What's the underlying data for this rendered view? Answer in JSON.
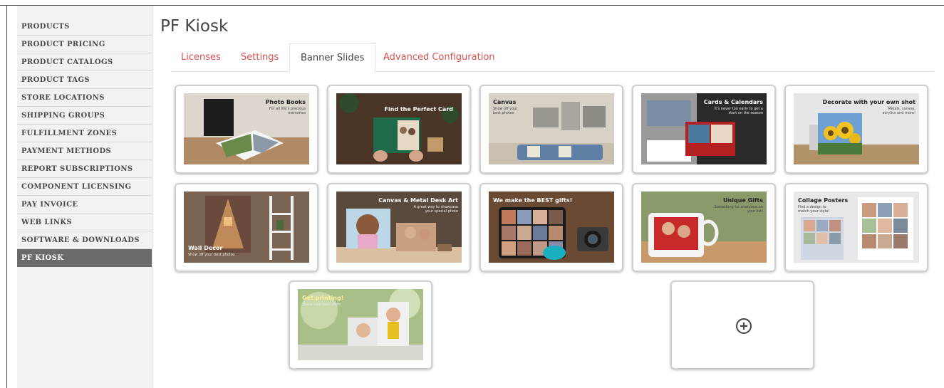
{
  "sidebar": {
    "items": [
      {
        "label": "PRODUCTS"
      },
      {
        "label": "PRODUCT PRICING"
      },
      {
        "label": "PRODUCT CATALOGS"
      },
      {
        "label": "PRODUCT TAGS"
      },
      {
        "label": "STORE LOCATIONS"
      },
      {
        "label": "SHIPPING GROUPS"
      },
      {
        "label": "FULFILLMENT ZONES"
      },
      {
        "label": "PAYMENT METHODS"
      },
      {
        "label": "REPORT SUBSCRIPTIONS"
      },
      {
        "label": "COMPONENT LICENSING"
      },
      {
        "label": "PAY INVOICE"
      },
      {
        "label": "WEB LINKS"
      },
      {
        "label": "SOFTWARE & DOWNLOADS"
      },
      {
        "label": "PF KIOSK",
        "active": true
      }
    ]
  },
  "page": {
    "title": "PF Kiosk"
  },
  "tabs": [
    {
      "label": "Licenses"
    },
    {
      "label": "Settings"
    },
    {
      "label": "Banner Slides",
      "active": true
    },
    {
      "label": "Advanced Configuration"
    }
  ],
  "slides": [
    {
      "title": "Photo Books",
      "subtitle": "For all life's precious memories"
    },
    {
      "title": "Find the Perfect Card",
      "subtitle": ""
    },
    {
      "title": "Canvas",
      "subtitle": "Show off your best photos"
    },
    {
      "title": "Cards & Calendars",
      "subtitle": "It's never too early to get a start on the season"
    },
    {
      "title": "Decorate with your own shot",
      "subtitle": "Metals, canvas, acrylics and more!"
    },
    {
      "title": "Wall Decor",
      "subtitle": "Show off your best photos"
    },
    {
      "title": "Canvas & Metal Desk Art",
      "subtitle": "A great way to showcase your special photo"
    },
    {
      "title": "We make the BEST gifts!",
      "subtitle": ""
    },
    {
      "title": "Unique Gifts",
      "subtitle": "Something for everyone on your list!"
    },
    {
      "title": "Collage Posters",
      "subtitle": "Find a design to match your style!"
    },
    {
      "title": "Get printing!",
      "subtitle": "Share your best shots"
    }
  ],
  "add_slide": {
    "icon": "plus-circle-icon"
  },
  "colors": {
    "tab_link": "#d9534f",
    "sidebar_active": "#6b6b6b",
    "sidebar_bg": "#f2f2f2"
  }
}
